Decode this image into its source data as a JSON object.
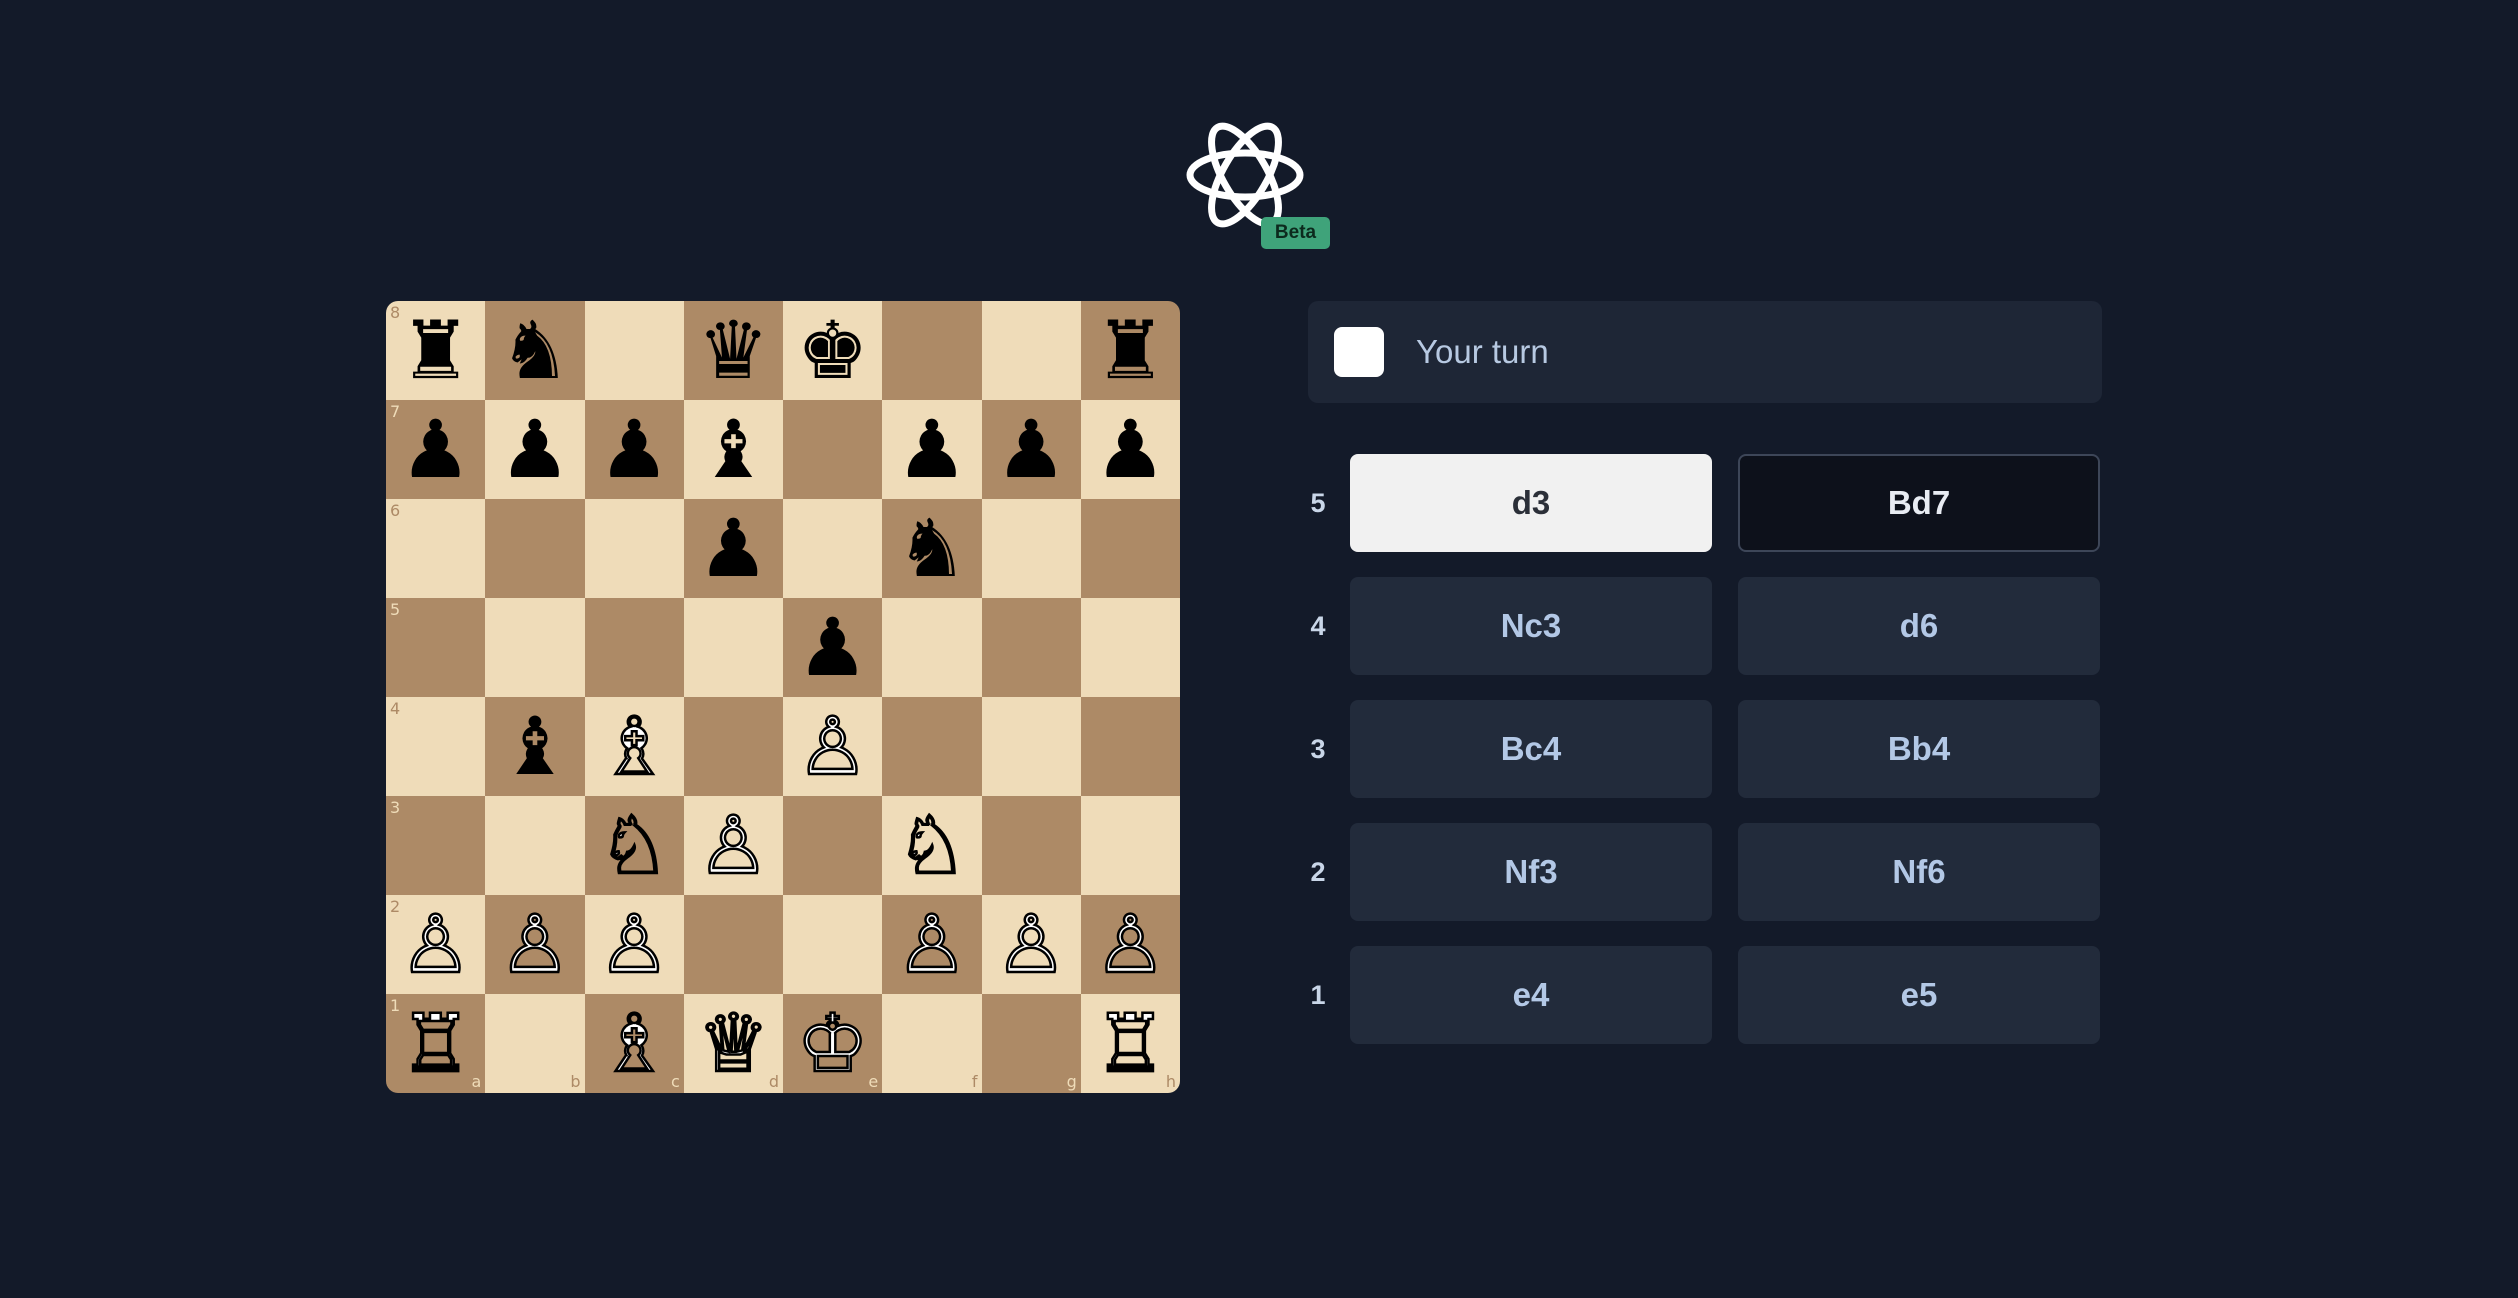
{
  "badge": "Beta",
  "status": {
    "label": "Your turn",
    "side_color": "#ffffff"
  },
  "board": {
    "ranks": [
      "8",
      "7",
      "6",
      "5",
      "4",
      "3",
      "2",
      "1"
    ],
    "files": [
      "a",
      "b",
      "c",
      "d",
      "e",
      "f",
      "g",
      "h"
    ],
    "light_color": "#efdcb9",
    "dark_color": "#ad8a66",
    "rows": [
      [
        "♜",
        "♞",
        "",
        "♛",
        "♚",
        "",
        "",
        "♜"
      ],
      [
        "♟",
        "♟",
        "♟",
        "♝",
        "",
        "♟",
        "♟",
        "♟"
      ],
      [
        "",
        "",
        "",
        "♟",
        "",
        "♞",
        "",
        ""
      ],
      [
        "",
        "",
        "",
        "",
        "♟",
        "",
        "",
        ""
      ],
      [
        "",
        "♝",
        "♗",
        "",
        "♙",
        "",
        "",
        ""
      ],
      [
        "",
        "",
        "♘",
        "♙",
        "",
        "♘",
        "",
        ""
      ],
      [
        "♙",
        "♙",
        "♙",
        "",
        "",
        "♙",
        "♙",
        "♙"
      ],
      [
        "♖",
        "",
        "♗",
        "♕",
        "♔",
        "",
        "",
        "♖"
      ]
    ]
  },
  "moves": [
    {
      "num": "5",
      "white": "d3",
      "black": "Bd7"
    },
    {
      "num": "4",
      "white": "Nc3",
      "black": "d6"
    },
    {
      "num": "3",
      "white": "Bc4",
      "black": "Bb4"
    },
    {
      "num": "2",
      "white": "Nf3",
      "black": "Nf6"
    },
    {
      "num": "1",
      "white": "e4",
      "black": "e5"
    }
  ]
}
